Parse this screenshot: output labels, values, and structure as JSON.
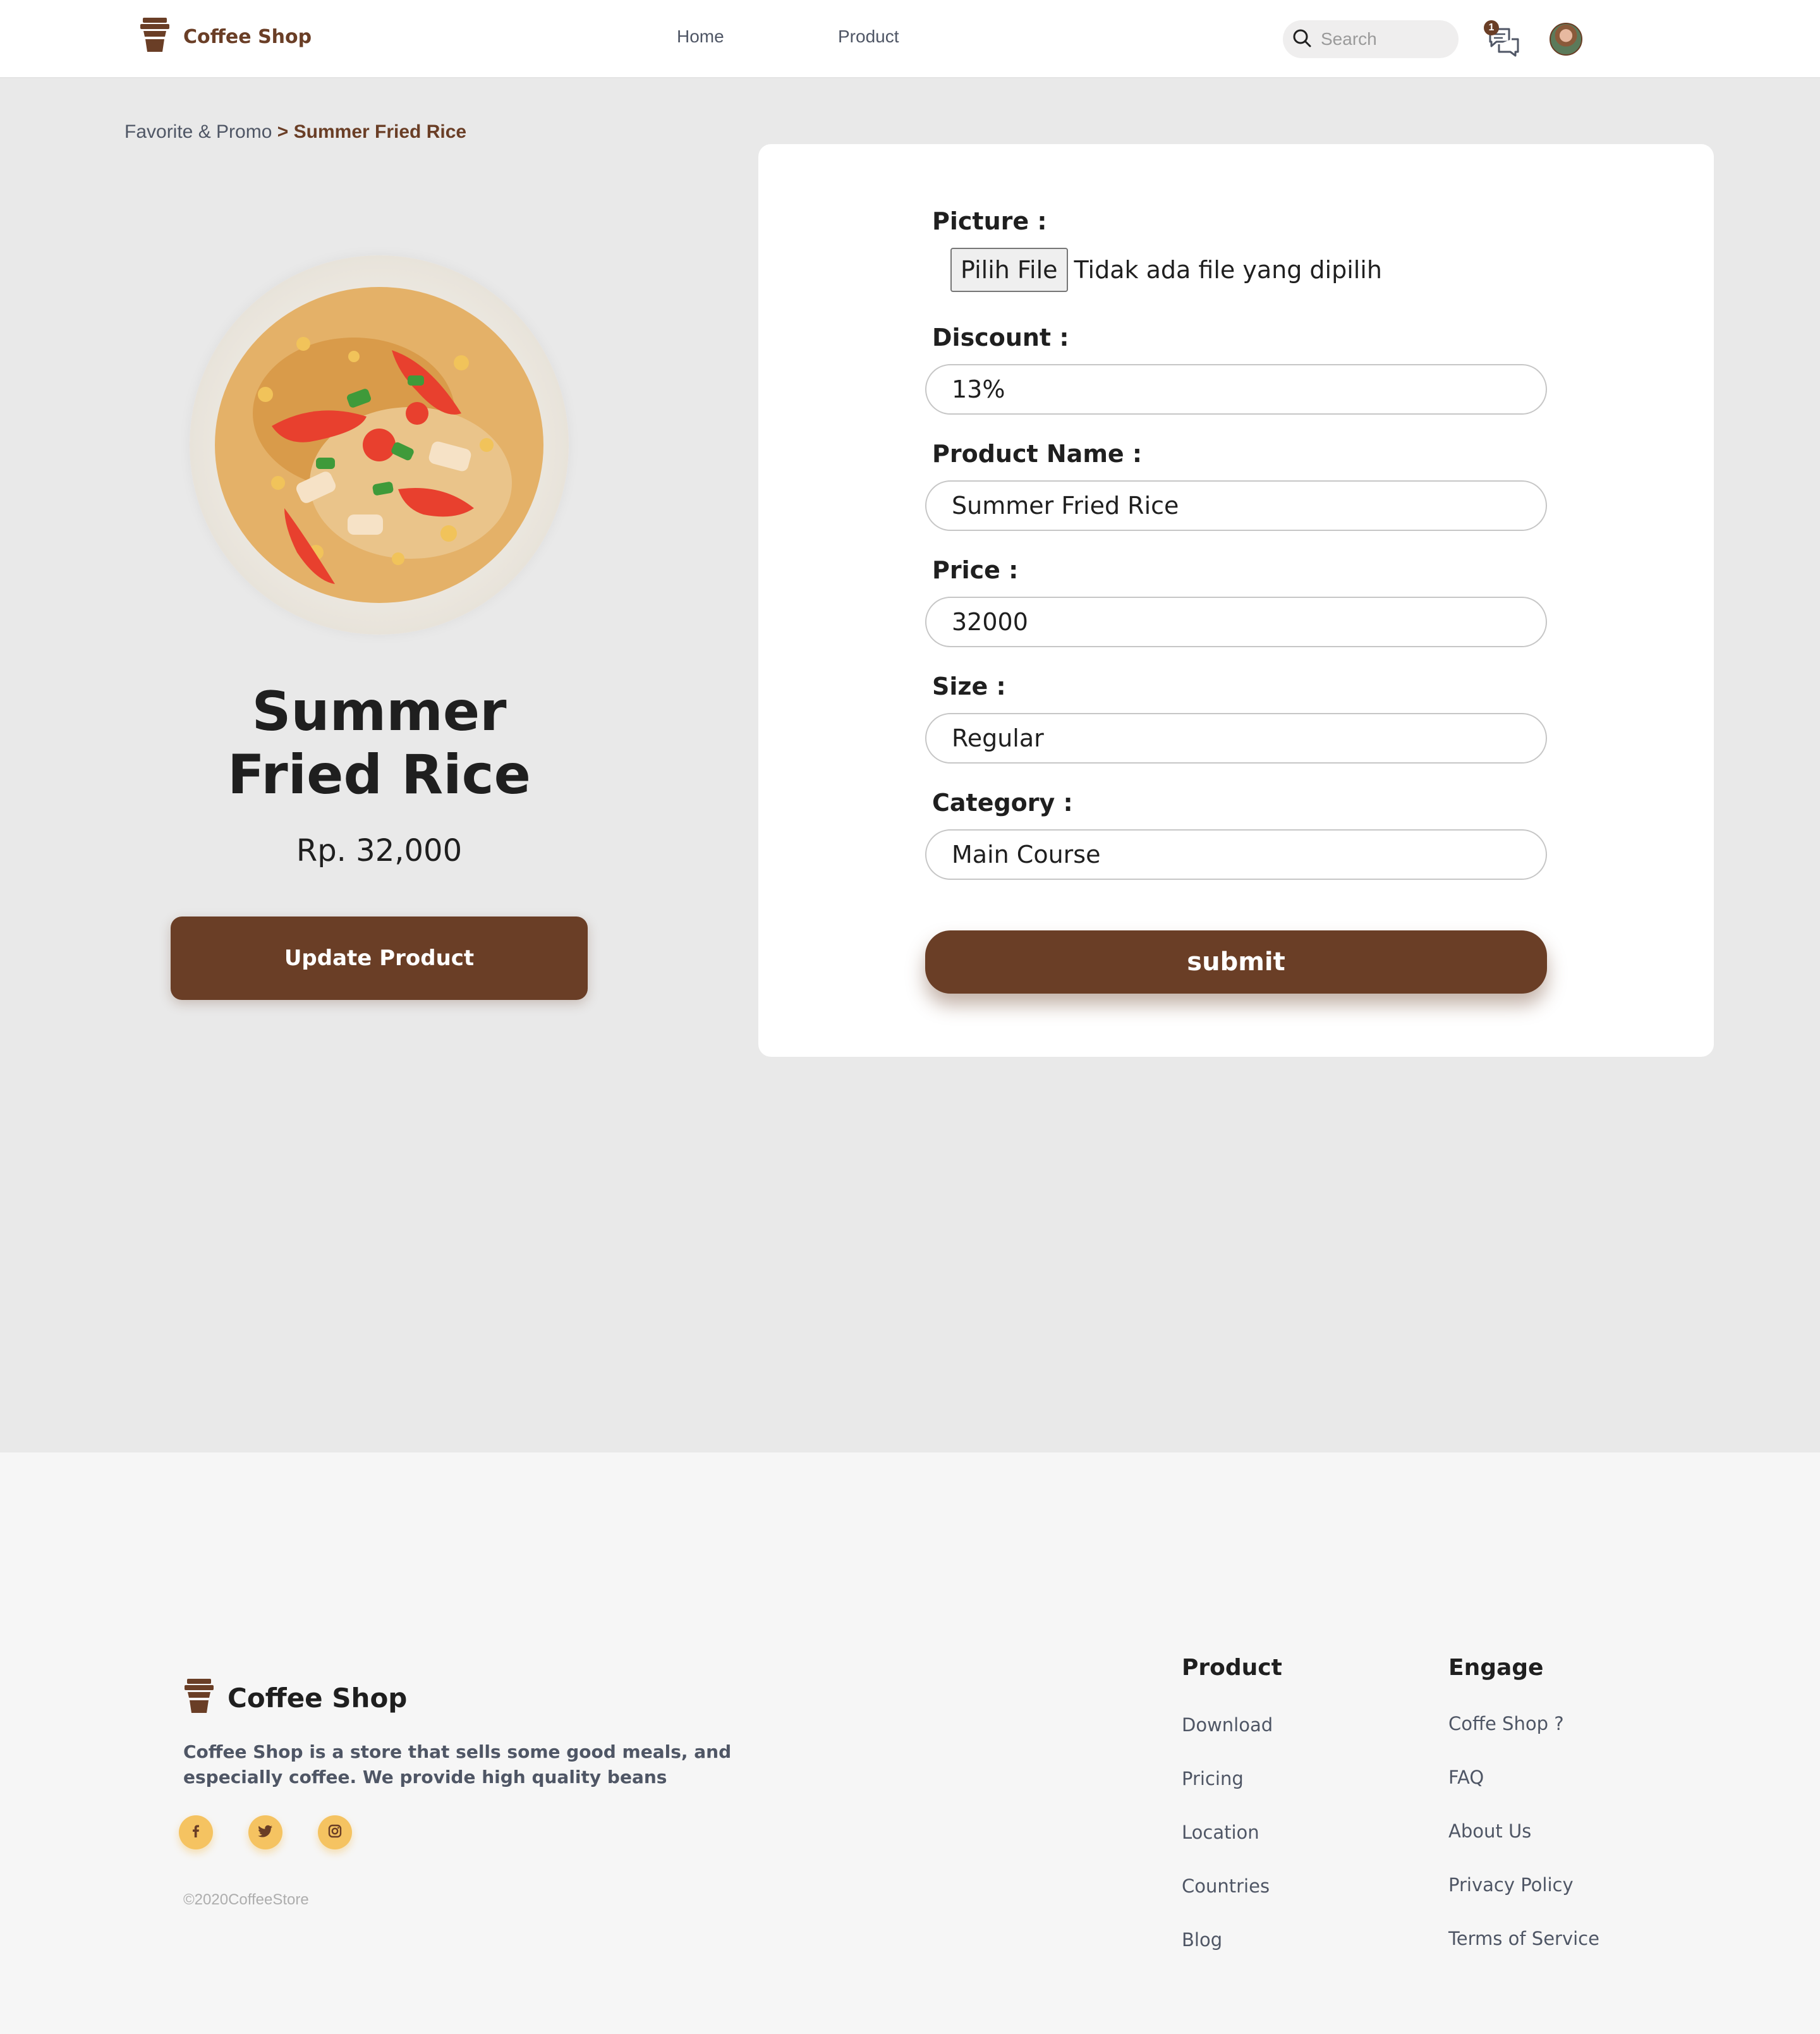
{
  "navbar": {
    "brand": "Coffee Shop",
    "links": [
      "Home",
      "Product"
    ],
    "search_placeholder": "Search",
    "chat_badge": "1"
  },
  "breadcrumb": {
    "parent": "Favorite & Promo",
    "separator": ">",
    "current": "Summer Fried Rice"
  },
  "product": {
    "title_line1": "Summer",
    "title_line2": "Fried Rice",
    "price": "Rp. 32,000",
    "update_button": "Update Product"
  },
  "form": {
    "picture_label": "Picture :",
    "file_button": "Pilih File",
    "file_status": "Tidak ada file yang dipilih",
    "discount_label": "Discount :",
    "discount_value": "13%",
    "name_label": "Product Name :",
    "name_value": "Summer Fried Rice",
    "price_label": "Price :",
    "price_value": "32000",
    "size_label": "Size :",
    "size_value": "Regular",
    "category_label": "Category :",
    "category_value": "Main Course",
    "submit_label": "submit"
  },
  "footer": {
    "brand": "Coffee Shop",
    "description": "Coffee Shop is a store that sells some good meals, and especially coffee. We provide high quality beans",
    "copyright": "©2020CoffeeStore",
    "product_title": "Product",
    "product_links": [
      "Download",
      "Pricing",
      "Location",
      "Countries",
      "Blog"
    ],
    "engage_title": "Engage",
    "engage_links": [
      "Coffe Shop ?",
      "FAQ",
      "About Us",
      "Privacy Policy",
      "Terms of Service"
    ]
  },
  "colors": {
    "brand_brown": "#6a3e26",
    "social_yellow": "#f5c361",
    "page_bg": "#e9e9e9"
  },
  "icons": [
    "coffee-cup-icon",
    "search-icon",
    "chat-icon",
    "facebook-icon",
    "twitter-icon",
    "instagram-icon"
  ]
}
